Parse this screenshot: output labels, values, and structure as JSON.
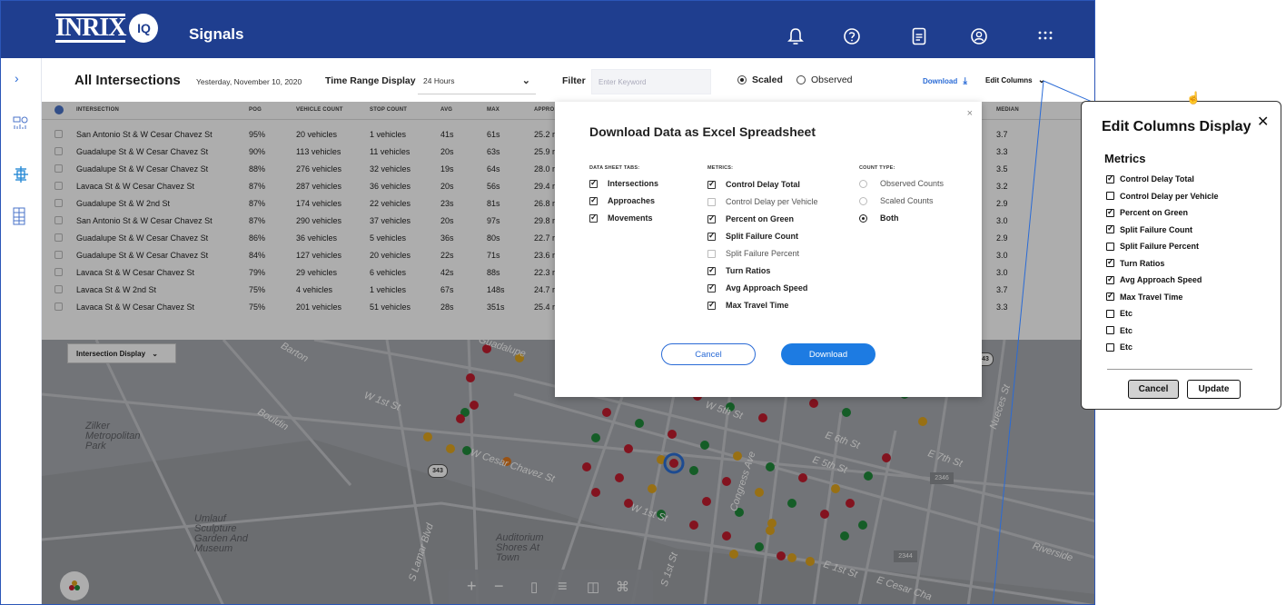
{
  "topbar": {
    "logo_text": "INRIX",
    "logo_badge": "IQ",
    "app_title": "Signals",
    "icons": [
      "bell-icon",
      "help-icon",
      "document-icon",
      "account-icon",
      "apps-icon"
    ]
  },
  "rail": {
    "expand_glyph": "›",
    "icons": [
      "dashboard-icon",
      "network-icon",
      "corridor-icon"
    ]
  },
  "header": {
    "title": "All Intersections",
    "date": "Yesterday, November 10, 2020",
    "time_range_label": "Time Range Display",
    "time_range_value": "24 Hours",
    "filter_label": "Filter",
    "filter_placeholder": "Enter Keyword",
    "radio_scaled": "Scaled",
    "radio_observed": "Observed",
    "download_label": "Download",
    "edit_columns_label": "Edit Columns"
  },
  "table": {
    "columns": [
      "INTERSECTION",
      "POG",
      "VEHICLE COUNT",
      "STOP COUNT",
      "AVG",
      "MAX",
      "APPRO",
      "MEDIAN"
    ],
    "rows": [
      {
        "intersection": "San Antonio St & W Cesar Chavez St",
        "pog": "95%",
        "vehicles": "20 vehicles",
        "stops": "1 vehicles",
        "avg": "41s",
        "max": "61s",
        "appro": "25.2 r",
        "median": "3.7"
      },
      {
        "intersection": "Guadalupe St & W Cesar Chavez St",
        "pog": "90%",
        "vehicles": "113 vehicles",
        "stops": "11 vehicles",
        "avg": "20s",
        "max": "63s",
        "appro": "25.9 r",
        "median": "3.3"
      },
      {
        "intersection": "Guadalupe St & W Cesar Chavez St",
        "pog": "88%",
        "vehicles": "276 vehicles",
        "stops": "32 vehicles",
        "avg": "19s",
        "max": "64s",
        "appro": "28.0 r",
        "median": "3.5"
      },
      {
        "intersection": "Lavaca St & W Cesar Chavez St",
        "pog": "87%",
        "vehicles": "287 vehicles",
        "stops": "36 vehicles",
        "avg": "20s",
        "max": "56s",
        "appro": "29.4 r",
        "median": "3.2"
      },
      {
        "intersection": "Guadalupe St & W 2nd St",
        "pog": "87%",
        "vehicles": "174 vehicles",
        "stops": "22 vehicles",
        "avg": "23s",
        "max": "81s",
        "appro": "26.8 r",
        "median": "2.9"
      },
      {
        "intersection": "San Antonio St & W Cesar Chavez St",
        "pog": "87%",
        "vehicles": "290 vehicles",
        "stops": "37 vehicles",
        "avg": "20s",
        "max": "97s",
        "appro": "29.8 r",
        "median": "3.0"
      },
      {
        "intersection": "Guadalupe St & W Cesar Chavez St",
        "pog": "86%",
        "vehicles": "36 vehicles",
        "stops": "5 vehicles",
        "avg": "36s",
        "max": "80s",
        "appro": "22.7 r",
        "median": "2.9"
      },
      {
        "intersection": "Guadalupe St & W Cesar Chavez St",
        "pog": "84%",
        "vehicles": "127 vehicles",
        "stops": "20 vehicles",
        "avg": "22s",
        "max": "71s",
        "appro": "23.6 r",
        "median": "3.0"
      },
      {
        "intersection": "Lavaca St & W Cesar Chavez St",
        "pog": "79%",
        "vehicles": "29 vehicles",
        "stops": "6 vehicles",
        "avg": "42s",
        "max": "88s",
        "appro": "22.3 r",
        "median": "3.0"
      },
      {
        "intersection": "Lavaca St & W 2nd St",
        "pog": "75%",
        "vehicles": "4 vehicles",
        "stops": "1 vehicles",
        "avg": "67s",
        "max": "148s",
        "appro": "24.7 r",
        "median": "3.7"
      },
      {
        "intersection": "Lavaca St & W Cesar Chavez St",
        "pog": "75%",
        "vehicles": "201 vehicles",
        "stops": "51 vehicles",
        "avg": "28s",
        "max": "351s",
        "appro": "25.4 r",
        "median": "3.3"
      }
    ]
  },
  "map": {
    "intersection_display_label": "Intersection Display",
    "labels": [
      "Zilker Metropolitan Park",
      "Umlauf Sculpture Garden And Museum",
      "Auditorium Shores At Town"
    ],
    "roads": [
      "W 1st St",
      "W Cesar Chavez St",
      "W 1st St",
      "E 6th St",
      "E 7th St",
      "E 1st St",
      "E Cesar Cha",
      "S Lamar Blvd",
      "Bouldin",
      "Congress Ave",
      "Guadalupe",
      "Barton",
      "Nueces St",
      "W 5th St",
      "E 5th St",
      "S 1st St",
      "Riverside"
    ],
    "route_badges": [
      "343",
      "343",
      "2346",
      "2344"
    ],
    "controls": [
      "zoom-in-icon",
      "zoom-out-icon",
      "map-icon",
      "list-icon",
      "split-view-icon",
      "route-icon"
    ],
    "colors": {
      "green": "#1f8a3a",
      "red": "#c21d2e",
      "yellow": "#e0a51e",
      "orange": "#e07a1e",
      "selected": "#2b6fd6"
    }
  },
  "modal": {
    "title": "Download Data as Excel Spreadsheet",
    "close": "×",
    "sheets_header": "DATA SHEET TABS:",
    "sheets": [
      {
        "label": "Intersections",
        "checked": true
      },
      {
        "label": "Approaches",
        "checked": true
      },
      {
        "label": "Movements",
        "checked": true
      }
    ],
    "metrics_header": "METRICS:",
    "metrics": [
      {
        "label": "Control Delay Total",
        "checked": true
      },
      {
        "label": "Control Delay per Vehicle",
        "checked": false
      },
      {
        "label": "Percent on Green",
        "checked": true
      },
      {
        "label": "Split Failure Count",
        "checked": true
      },
      {
        "label": "Split Failure Percent",
        "checked": false
      },
      {
        "label": "Turn Ratios",
        "checked": true
      },
      {
        "label": "Avg Approach Speed",
        "checked": true
      },
      {
        "label": "Max Travel Time",
        "checked": true
      }
    ],
    "count_header": "COUNT TYPE:",
    "count_types": [
      {
        "label": "Observed Counts",
        "selected": false
      },
      {
        "label": "Scaled Counts",
        "selected": false
      },
      {
        "label": "Both",
        "selected": true
      }
    ],
    "cancel_label": "Cancel",
    "download_label": "Download"
  },
  "edit_columns": {
    "title": "Edit Columns Display",
    "close": "✕",
    "section": "Metrics",
    "items": [
      {
        "label": "Control Delay Total",
        "checked": true
      },
      {
        "label": "Control Delay per Vehicle",
        "checked": false
      },
      {
        "label": "Percent on Green",
        "checked": true
      },
      {
        "label": "Split Failure Count",
        "checked": true
      },
      {
        "label": "Split Failure Percent",
        "checked": false
      },
      {
        "label": "Turn Ratios",
        "checked": true
      },
      {
        "label": "Avg Approach Speed",
        "checked": true
      },
      {
        "label": "Max Travel Time",
        "checked": true
      },
      {
        "label": "Etc",
        "checked": false
      },
      {
        "label": "Etc",
        "checked": false
      },
      {
        "label": "Etc",
        "checked": false
      }
    ],
    "cancel_label": "Cancel",
    "update_label": "Update"
  }
}
